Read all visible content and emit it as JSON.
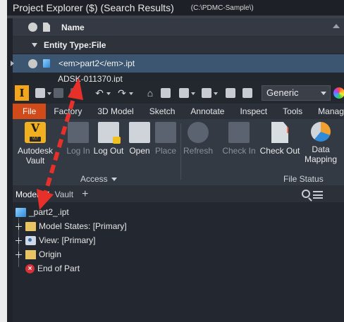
{
  "explorer": {
    "title": "Project Explorer ($)    (Search Results)",
    "path": "(C:\\PDMC-Sample\\)",
    "column_name": "Name",
    "group_label": "Entity Type:File",
    "rows": [
      {
        "name": "<em>part2</em>.ipt"
      },
      {
        "name": "ADSK-011370.ipt"
      }
    ]
  },
  "inventor": {
    "logo": "I",
    "style_combo": "Generic",
    "tabs": [
      "File",
      "Factory",
      "3D Model",
      "Sketch",
      "Annotate",
      "Inspect",
      "Tools",
      "Manage"
    ],
    "ribbon": {
      "autodesk_vault": "Autodesk Vault",
      "vault_badge": "VLT",
      "log_in": "Log In",
      "log_out": "Log Out",
      "open": "Open",
      "place": "Place",
      "refresh": "Refresh",
      "check_in": "Check In",
      "check_out": "Check Out",
      "data_mapping": "Data Mapping",
      "panel_access": "Access",
      "panel_file_status": "File Status"
    },
    "browser": {
      "tab_model": "Model",
      "tab_vault": "Vault",
      "add": "+",
      "close": "✕",
      "nodes": {
        "root": "_part2_.ipt",
        "model_states": "Model States: [Primary]",
        "view": "View: [Primary]",
        "origin": "Origin",
        "end_of_part": "End of Part"
      }
    }
  },
  "colors": {
    "file_tab": "#d04a1a",
    "selected_row": "#3c5570",
    "arrow": "#e8302a",
    "vault_icon": "#f0b020"
  }
}
